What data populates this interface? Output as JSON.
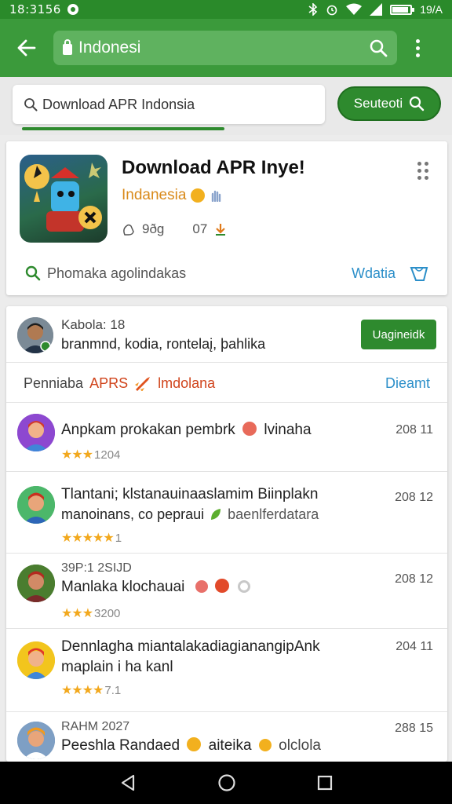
{
  "status_bar": {
    "time": "18:3156",
    "battery_text": "19/A"
  },
  "app_bar": {
    "search_text": "Indonesi"
  },
  "search": {
    "query": "Download APR Indonsia",
    "button_label": "Seuteoti"
  },
  "app_card": {
    "title": "Download APR Inye!",
    "developer": "Indanesia",
    "meta_1": "9ðg",
    "meta_2": "07",
    "footer_text": "Phomaka agolindakas",
    "footer_link": "Wdatia"
  },
  "user": {
    "name": "Kabola: 18",
    "subtitle": "branmnd, kodia, rontelaį, þahlika",
    "button_label": "Uagineidk"
  },
  "section": {
    "label": "Penniaba",
    "highlight": "APRS",
    "subtitle": "lmdolana",
    "more_link": "Dieamt"
  },
  "reviews": [
    {
      "meta": "",
      "line1": "Anpkam prokakan pembrk",
      "line1_tail": "lvinaha",
      "line2": "",
      "rating": 3,
      "rating_text": "1204",
      "date": "208 11"
    },
    {
      "meta": "",
      "line1": "Tlantani; klstanauinaaslamim Biinplakn",
      "line1_tail": "",
      "line2": "manoinans, co pepraui",
      "line2_tail": "baenlferdatara",
      "rating": 5,
      "rating_text": "1",
      "date": "208 12"
    },
    {
      "meta": "39P:1 2SIJD",
      "line1": "Manlaka klochauai",
      "line1_tail": "",
      "line2": "",
      "rating": 3,
      "rating_text": "3200",
      "date": "208 12"
    },
    {
      "meta": "",
      "line1": "Dennlagha miantalakadiagianangipAnk",
      "line1_tail": "",
      "line2": "maplain i ha kanl",
      "rating": 4,
      "rating_text": "7.1",
      "date": "204 11"
    },
    {
      "meta": "RAHM 2027",
      "line1": "Peeshla Randaed",
      "line1_tail": "aiteika",
      "line1_tail2": "olclola",
      "line2": "",
      "rating": 0,
      "rating_text": "",
      "date": "288 15"
    }
  ],
  "colors": {
    "primary_green": "#3b9a3b",
    "dark_green": "#2e8a2e",
    "link_blue": "#2c8fc9",
    "accent_orange": "#d0441c",
    "star": "#f2a81d"
  },
  "icons": [
    "back-arrow-icon",
    "lock-icon",
    "search-icon",
    "more-vert-icon",
    "rating-icon",
    "download-icon",
    "tag-icon",
    "rocket-icon",
    "nav-back-icon",
    "nav-home-icon",
    "nav-recents-icon"
  ]
}
